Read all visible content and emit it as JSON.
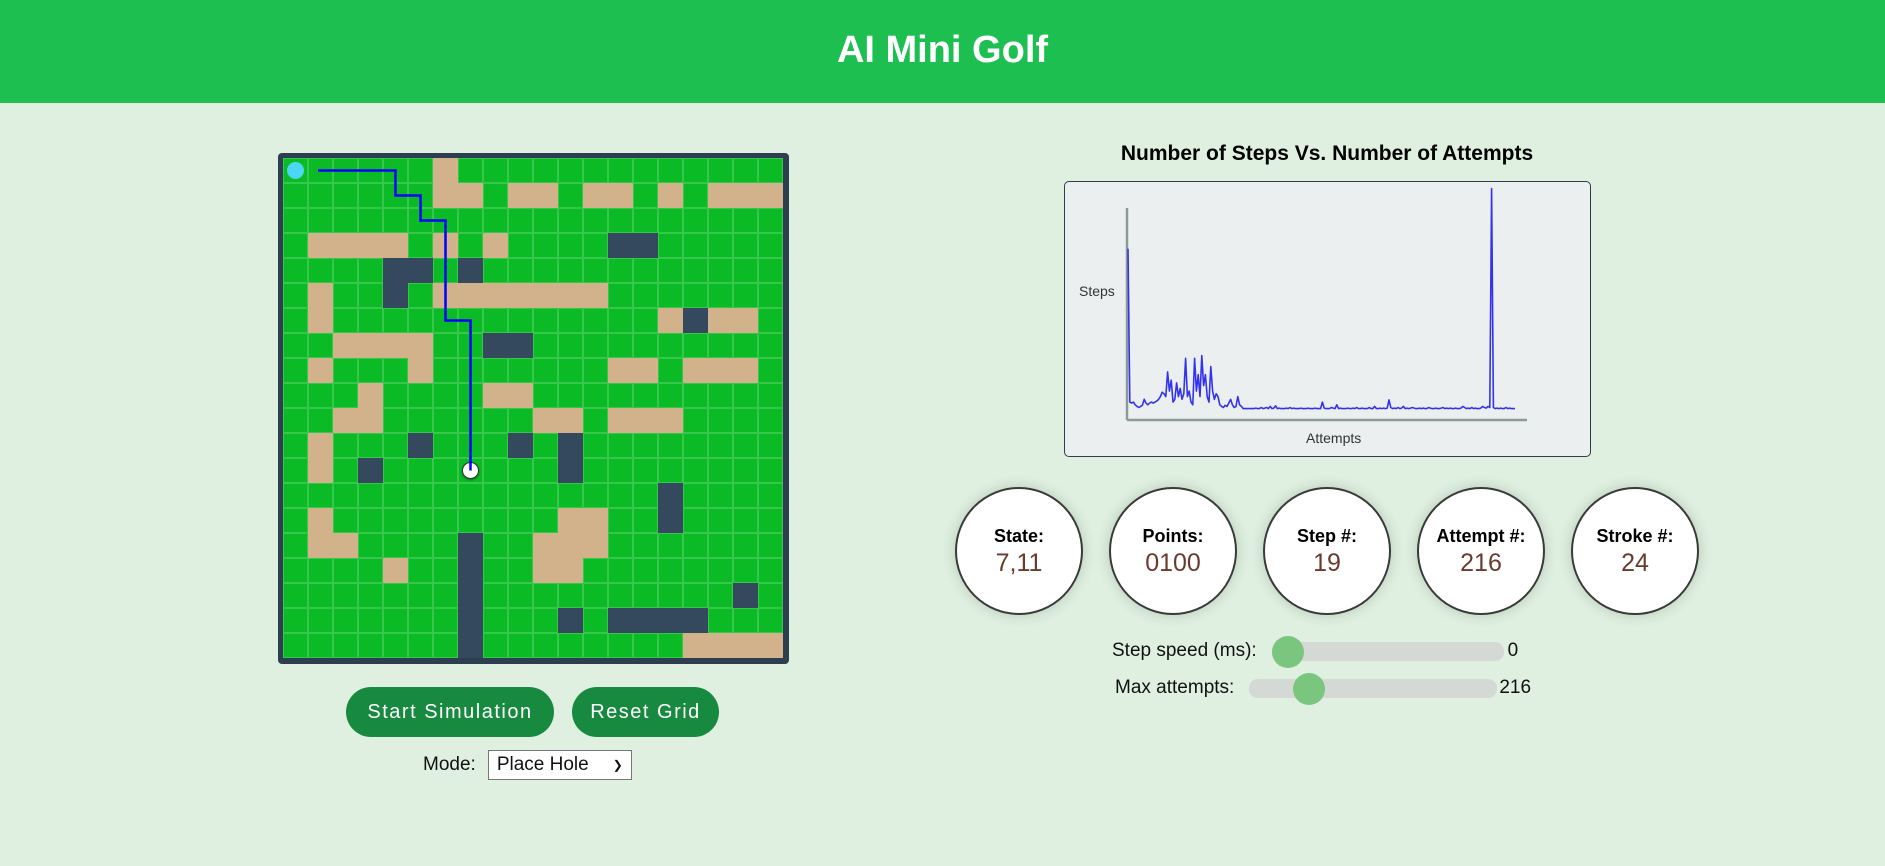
{
  "header": {
    "title": "AI Mini Golf"
  },
  "grid": {
    "size": 20,
    "legend": {
      "g": "grass",
      "s": "sand",
      "d": "wall"
    },
    "colors": {
      "grass": "#0abb25",
      "sand": "#d1b28b",
      "wall": "#34495e",
      "ball": "#4dd6f4",
      "path": "#0000ff"
    },
    "rows": [
      "ggggggsggggggggggggg",
      "ggggggssgssgssgsgsss",
      "gggggggggggggggggggg",
      "gssssgsgsggggddggggg",
      "ggggddgdgggggggggggg",
      "gsggdgsssssssggggggg",
      "gsgggggggggggggsdssgs",
      "ggssssggddgggggggggg",
      "gsgggsgggggggssgsssg",
      "gggsggggssgggggggggg",
      "ggssggggggssgsssgggg",
      "gsgggdgggdgdgggggggg",
      "gsgdgggggggdgggggggg",
      "gggggggggggggggdgggg",
      "gsgggggggggssggdgggg",
      "gssggggdggsssggggggg",
      "ggggsggdggssgggggggg",
      "gggggggdggggggggggdg",
      "gggggggdgggdgddddggg",
      "gggggggdggggggggssss"
    ],
    "ball": {
      "row": 0,
      "col": 0
    },
    "hole": {
      "row": 12,
      "col": 7
    },
    "path": [
      [
        0,
        1
      ],
      [
        0,
        4
      ],
      [
        1,
        4
      ],
      [
        1,
        5
      ],
      [
        2,
        5
      ],
      [
        2,
        6
      ],
      [
        6,
        6
      ],
      [
        6,
        7
      ],
      [
        12,
        7
      ]
    ]
  },
  "controls": {
    "start_label": "Start Simulation",
    "reset_label": "Reset Grid",
    "mode_label": "Mode:",
    "mode_value": "Place Hole"
  },
  "stats": [
    {
      "label": "State:",
      "value": "7,11"
    },
    {
      "label": "Points:",
      "value": "0100"
    },
    {
      "label": "Step #:",
      "value": "19"
    },
    {
      "label": "Attempt #:",
      "value": "216"
    },
    {
      "label": "Stroke #:",
      "value": "24"
    }
  ],
  "sliders": {
    "speed": {
      "label": "Step speed (ms):",
      "value": "0",
      "fraction": 0.0
    },
    "attempts": {
      "label": "Max attempts:",
      "value": "216",
      "fraction": 0.2
    }
  },
  "chart_data": {
    "type": "line",
    "title": "Number of Steps Vs. Number of Attempts",
    "xlabel": "Attempts",
    "ylabel": "Steps",
    "grid": false,
    "legend": "none",
    "color": "#3333ee",
    "xlim": [
      1,
      216
    ],
    "ylim": [
      0,
      400
    ],
    "x_note": "attempt index 1..216",
    "values": [
      300,
      20,
      18,
      20,
      15,
      12,
      10,
      12,
      14,
      25,
      18,
      15,
      18,
      20,
      18,
      20,
      22,
      25,
      30,
      38,
      35,
      30,
      75,
      40,
      60,
      20,
      25,
      55,
      30,
      45,
      25,
      35,
      100,
      30,
      40,
      20,
      15,
      100,
      40,
      70,
      30,
      105,
      50,
      70,
      30,
      20,
      85,
      40,
      25,
      35,
      30,
      15,
      12,
      10,
      14,
      12,
      18,
      25,
      15,
      10,
      12,
      30,
      15,
      12,
      8,
      8,
      8,
      8,
      8,
      8,
      8,
      9,
      8,
      8,
      10,
      8,
      9,
      10,
      8,
      12,
      8,
      9,
      13,
      8,
      9,
      8,
      8,
      8,
      9,
      8,
      10,
      8,
      9,
      8,
      8,
      8,
      9,
      8,
      8,
      8,
      9,
      8,
      8,
      8,
      9,
      8,
      8,
      8,
      20,
      9,
      8,
      8,
      8,
      10,
      9,
      8,
      15,
      8,
      9,
      8,
      8,
      8,
      9,
      8,
      8,
      9,
      8,
      10,
      8,
      8,
      9,
      8,
      8,
      8,
      10,
      8,
      8,
      12,
      8,
      8,
      9,
      8,
      9,
      8,
      9,
      24,
      10,
      8,
      9,
      8,
      10,
      8,
      9,
      12,
      8,
      9,
      8,
      9,
      10,
      9,
      8,
      8,
      9,
      8,
      9,
      8,
      8,
      10,
      9,
      8,
      8,
      9,
      8,
      8,
      9,
      10,
      8,
      9,
      8,
      9,
      8,
      8,
      9,
      8,
      8,
      9,
      12,
      10,
      8,
      9,
      8,
      10,
      8,
      9,
      8,
      8,
      9,
      12,
      10,
      9,
      12,
      10,
      410,
      10,
      8,
      9,
      8,
      9,
      8,
      8,
      10,
      8,
      9,
      8,
      8,
      8
    ]
  }
}
